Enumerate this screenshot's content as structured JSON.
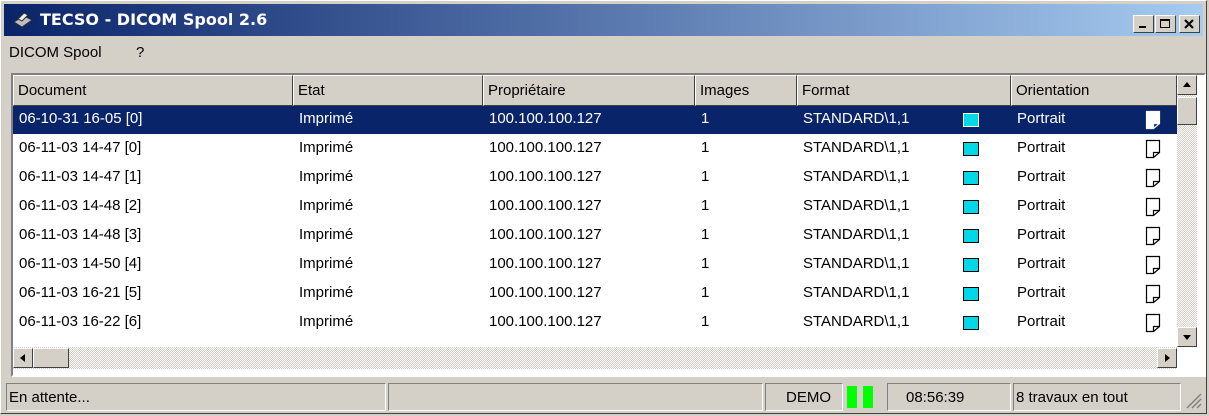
{
  "window": {
    "title": "TECSO - DICOM Spool 2.6"
  },
  "menu": {
    "items": [
      "DICOM Spool",
      "?"
    ]
  },
  "columns": [
    "Document",
    "Etat",
    "Propriétaire",
    "Images",
    "Format",
    "Orientation"
  ],
  "rows": [
    {
      "document": "06-10-31 16-05 [0]",
      "etat": "Imprimé",
      "proprietaire": "100.100.100.127",
      "images": "1",
      "format": "STANDARD\\1,1",
      "orientation": "Portrait",
      "selected": true
    },
    {
      "document": "06-11-03 14-47 [0]",
      "etat": "Imprimé",
      "proprietaire": "100.100.100.127",
      "images": "1",
      "format": "STANDARD\\1,1",
      "orientation": "Portrait"
    },
    {
      "document": "06-11-03 14-47 [1]",
      "etat": "Imprimé",
      "proprietaire": "100.100.100.127",
      "images": "1",
      "format": "STANDARD\\1,1",
      "orientation": "Portrait"
    },
    {
      "document": "06-11-03 14-48 [2]",
      "etat": "Imprimé",
      "proprietaire": "100.100.100.127",
      "images": "1",
      "format": "STANDARD\\1,1",
      "orientation": "Portrait"
    },
    {
      "document": "06-11-03 14-48 [3]",
      "etat": "Imprimé",
      "proprietaire": "100.100.100.127",
      "images": "1",
      "format": "STANDARD\\1,1",
      "orientation": "Portrait"
    },
    {
      "document": "06-11-03 14-50 [4]",
      "etat": "Imprimé",
      "proprietaire": "100.100.100.127",
      "images": "1",
      "format": "STANDARD\\1,1",
      "orientation": "Portrait"
    },
    {
      "document": "06-11-03 16-21 [5]",
      "etat": "Imprimé",
      "proprietaire": "100.100.100.127",
      "images": "1",
      "format": "STANDARD\\1,1",
      "orientation": "Portrait"
    },
    {
      "document": "06-11-03 16-22 [6]",
      "etat": "Imprimé",
      "proprietaire": "100.100.100.127",
      "images": "1",
      "format": "STANDARD\\1,1",
      "orientation": "Portrait"
    }
  ],
  "colors": {
    "format_swatch": "#00d8e8",
    "status_led": "#00ff00",
    "selection": "#0a246a"
  },
  "status": {
    "message": "En attente...",
    "mode": "DEMO",
    "time": "08:56:39",
    "total": "8 travaux en tout"
  }
}
